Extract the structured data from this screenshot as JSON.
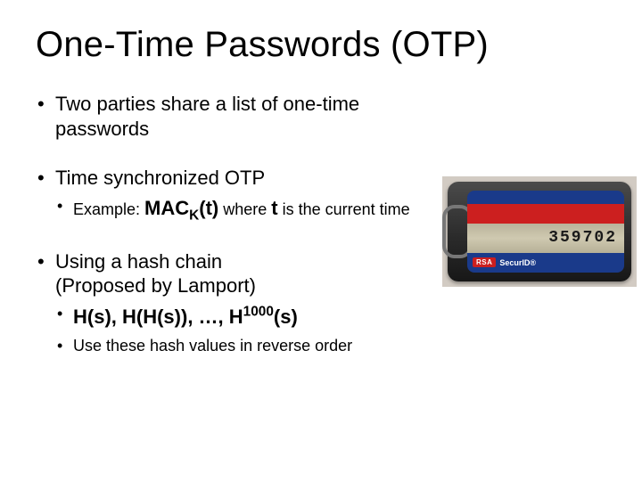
{
  "title": "One-Time Passwords (OTP)",
  "bullets": {
    "b1": "Two parties share a list of one-time passwords",
    "b2": "Time synchronized OTP",
    "b2s_prefix": "Example: ",
    "b2s_mac_a": "MAC",
    "b2s_mac_sub": "K",
    "b2s_mac_b": "(t)",
    "b2s_mid": " where ",
    "b2s_t": "t",
    "b2s_suffix": " is the current time",
    "b3a": "Using a hash chain",
    "b3b": "(Proposed by Lamport)",
    "b3s1_a": "H(s), H(H(s)), …, H",
    "b3s1_sup": "1000",
    "b3s1_b": "(s)",
    "b3s2": "Use these hash values in reverse order"
  },
  "token": {
    "digits": "359702",
    "brand": "RSA",
    "product": "SecurID®"
  }
}
